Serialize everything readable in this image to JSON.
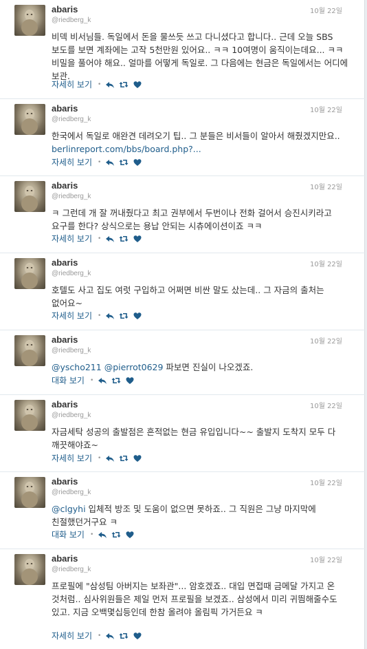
{
  "user": {
    "name": "abaris",
    "handle": "@riedberg_k"
  },
  "colors": {
    "accent": "#1f5d8b",
    "text": "#333333",
    "muted": "#999999"
  },
  "icons": [
    "reply-icon",
    "retweet-icon",
    "favorite-icon"
  ],
  "tweets": [
    {
      "time": "10월 22일",
      "text": "비덱 비서님들. 독일에서 돈을 물쓰듯 쓰고 다니셨다고 합니다.. 근데 오늘 SBS 보도를 보면 계좌에는 고작 5천만원 있어요.. ㅋㅋ 10여명이 움직이는데요... ㅋㅋ 비밀을 풀어야 해요.. 얼마를 어떻게 독일로. 그 다음에는 현금은 독일에서는 어디에 보관.",
      "action": "자세히 보기"
    },
    {
      "time": "10월 22일",
      "text": "한국에서 독일로 애완견 데려오기 팁.. 그 분들은 비서들이 알아서 해줬겠지만요.. ",
      "link": "berlinreport.com/bbs/board.php?...",
      "action": "자세히 보기"
    },
    {
      "time": "10월 22일",
      "text": "ㅋ 그런데 개 잘 꺼내줬다고 최고 권부에서 두번이나 전화 걸어서 승진시키라고 요구를 한다? 상식으로는 용납 안되는 시츄에이션이죠 ㅋㅋ",
      "action": "자세히 보기"
    },
    {
      "time": "10월 22일",
      "text": "호텔도 사고 집도 여럿 구입하고 어쩌면 비싼 말도 샀는데.. 그 자금의 출처는 없어요~",
      "action": "자세히 보기"
    },
    {
      "time": "10월 22일",
      "mention1": "@yscho211",
      "mention2": "@pierrot0629",
      "text": " 파보면 진실이 나오겠죠.",
      "action": "대화 보기"
    },
    {
      "time": "10월 22일",
      "text": "자금세탁 성공의 출발점은 흔적없는 현금 유입입니다~~ 출발지 도착지 모두 다 깨끗해야죠~",
      "action": "자세히 보기"
    },
    {
      "time": "10월 22일",
      "mention1": "@clgyhi",
      "text": " 입체적 방조 및 도움이 없으면 못하죠.. 그 직원은 그냥 마지막에 친절했던거구요 ㅋ",
      "action": "대화 보기"
    },
    {
      "time": "10월 22일",
      "text": "프로필에 \"삼성팀 아버지는 보좌관\"... 암호겠죠.. 대입 면접때 금메달 가지고 온 것처럼.. 심사위원들은 제일 먼저 프로필을 보겠죠.. 삼성에서 미리 귀띔해줄수도 있고. 지금 오백몇십등인데 한참 올려야 올림픽 가거든요 ㅋ",
      "action": "자세히 보기"
    }
  ]
}
